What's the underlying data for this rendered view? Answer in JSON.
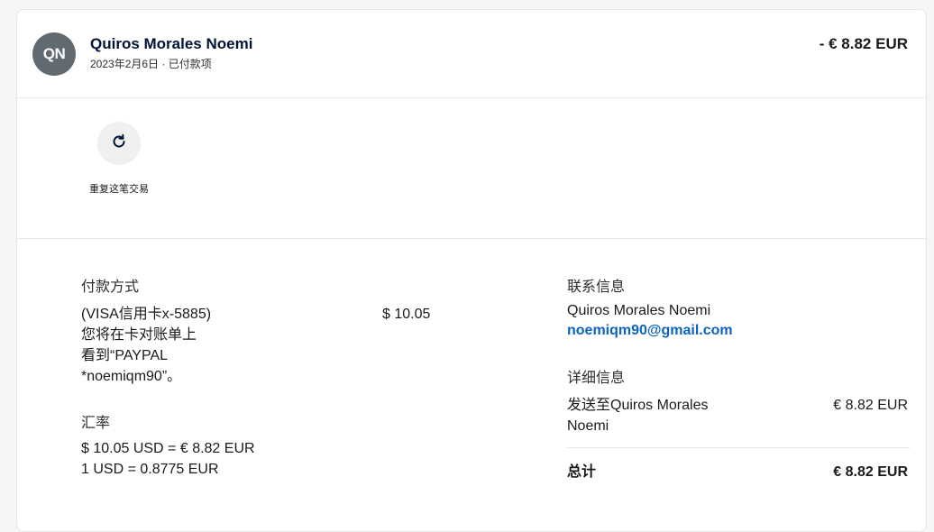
{
  "header": {
    "avatar_initials": "QN",
    "name": "Quiros Morales Noemi",
    "date_status": "2023年2月6日 · 已付款项",
    "amount": "- € 8.82 EUR"
  },
  "actions": {
    "repeat_label": "重复这笔交易"
  },
  "payment": {
    "title": "付款方式",
    "method_line1": "(VISA信用卡x-5885)",
    "method_line2": "您将在卡对账单上",
    "method_line3": "看到“PAYPAL",
    "method_line4": "*noemiqm90”。",
    "amount": "$ 10.05",
    "exchange_title": "汇率",
    "exchange_line1": "$ 10.05 USD = € 8.82 EUR",
    "exchange_line2": "1 USD = 0.8775 EUR"
  },
  "contact": {
    "title": "联系信息",
    "name": "Quiros Morales Noemi",
    "email": "noemiqm90@gmail.com"
  },
  "detail": {
    "title": "详细信息",
    "sent_to_line1": "发送至Quiros Morales",
    "sent_to_line2": "Noemi",
    "sent_amount": "€ 8.82 EUR",
    "total_label": "总计",
    "total_amount": "€ 8.82 EUR"
  },
  "colors": {
    "avatar_bg": "#626a71",
    "link": "#0c64c0",
    "name": "#001435"
  },
  "icons": {
    "repeat": "refresh-icon"
  }
}
